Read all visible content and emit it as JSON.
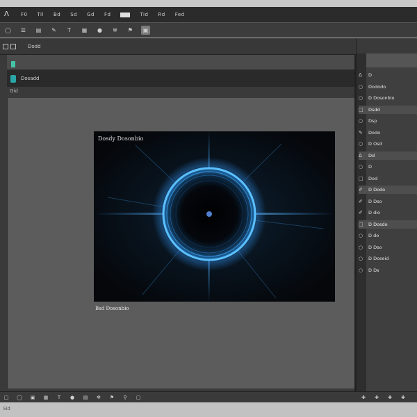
{
  "menu": {
    "logo_icon": "triangle-logo-icon",
    "items": [
      "F0",
      "Til",
      "Bd",
      "Sd",
      "Gd",
      "Fd",
      "",
      "Tid",
      "Rd",
      "Fed"
    ]
  },
  "toolbar": {
    "icons": [
      "circle-icon",
      "list-icon",
      "image-icon",
      "pen-icon",
      "text-icon",
      "grid-icon",
      "circle-icon",
      "brush-icon",
      "flag-icon",
      "photo-icon"
    ]
  },
  "panel": {
    "header_title": "Dodd",
    "layer_label": "Dosadd",
    "tab_label": "Gid"
  },
  "artwork": {
    "title": "Dosdy Dosonbio",
    "caption": "Bsd Dosonbio",
    "ring_color": "#4fb2f0",
    "glow_color": "#2a7fd0"
  },
  "right_panel": {
    "items": [
      {
        "icon": "lock-icon",
        "label": "D"
      },
      {
        "icon": "eye-icon",
        "label": "Dododo"
      },
      {
        "icon": "eye-icon",
        "label": "D Dosonbio"
      },
      {
        "icon": "square-icon",
        "label": "Dsdd"
      },
      {
        "icon": "eye-icon",
        "label": "Dsp"
      },
      {
        "icon": "brush-icon",
        "label": "Dodo"
      },
      {
        "icon": "eye-icon",
        "label": "D Osd"
      },
      {
        "icon": "lock-icon",
        "label": "Dd"
      },
      {
        "icon": "eye-icon",
        "label": "D"
      },
      {
        "icon": "square-icon",
        "label": "Dod"
      },
      {
        "icon": "pen-icon",
        "label": "D Dodo"
      },
      {
        "icon": "pen-icon",
        "label": "D Dso"
      },
      {
        "icon": "pen-icon",
        "label": "D dio"
      },
      {
        "icon": "square-icon",
        "label": "D Dosdo"
      },
      {
        "icon": "eye-icon",
        "label": "D do"
      },
      {
        "icon": "eye-icon",
        "label": "D Dso"
      },
      {
        "icon": "eye-icon",
        "label": "D Doseid"
      },
      {
        "icon": "eye-icon",
        "label": "D Ds"
      }
    ]
  },
  "statusbar": {
    "icons": [
      "square-icon",
      "circle-icon",
      "square-icon",
      "film-icon",
      "text-icon",
      "dot-icon",
      "grid-icon",
      "brush-icon",
      "flag-icon",
      "zoom-icon",
      "frame-icon"
    ],
    "right_icons": [
      "cross-icon",
      "cross-icon",
      "cross-icon",
      "cross-icon"
    ]
  },
  "bottom": {
    "text": "Sid"
  }
}
